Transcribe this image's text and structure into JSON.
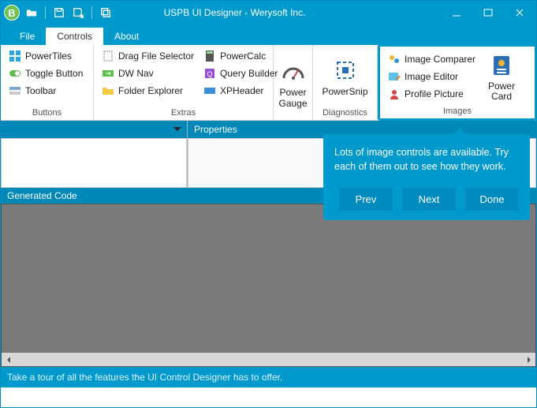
{
  "window": {
    "title": "USPB UI Designer - Werysoft Inc."
  },
  "menu": {
    "file": "File",
    "controls": "Controls",
    "about": "About"
  },
  "ribbon": {
    "buttons_group": "Buttons",
    "extras_group": "Extras",
    "diagnostics_group": "Diagnostics",
    "images_group": "Images",
    "powertiles": "PowerTiles",
    "toggle_button": "Toggle Button",
    "toolbar": "Toolbar",
    "drag_file": "Drag File Selector",
    "dw_nav": "DW Nav",
    "folder_explorer": "Folder Explorer",
    "powercalc": "PowerCalc",
    "query_builder": "Query Builder",
    "xpheader": "XPHeader",
    "power_gauge": "Power\nGauge",
    "powersnip": "PowerSnip",
    "image_comparer": "Image Comparer",
    "image_editor": "Image Editor",
    "profile_picture": "Profile Picture",
    "power_card": "Power\nCard"
  },
  "panels": {
    "properties": "Properties",
    "generated_code": "Generated Code"
  },
  "callout": {
    "text": "Lots of image controls are available. Try each of them out to see how they work.",
    "prev": "Prev",
    "next": "Next",
    "done": "Done"
  },
  "status": "Take a tour of all the features the UI Control Designer has to offer."
}
